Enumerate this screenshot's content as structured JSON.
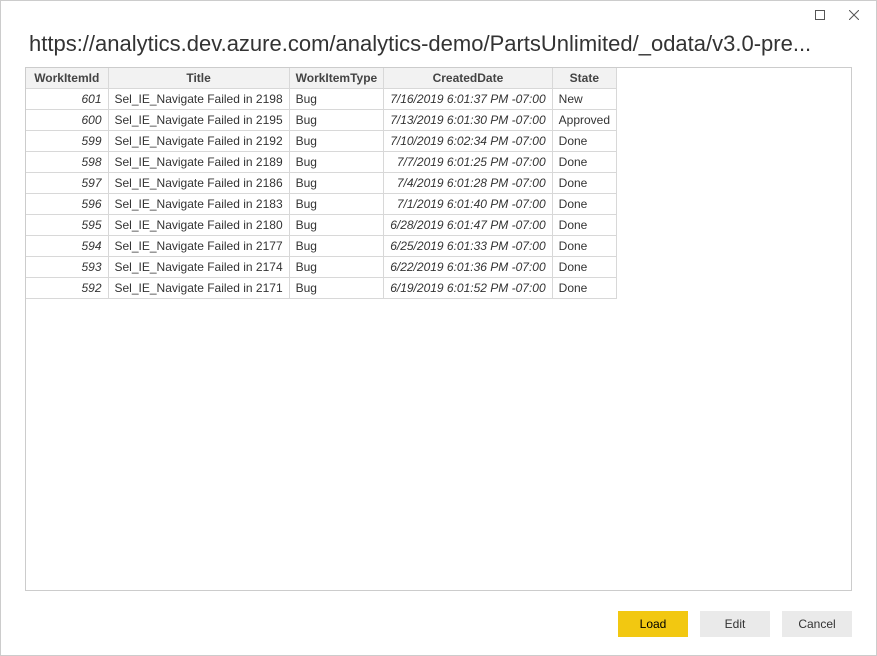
{
  "window": {
    "title_url": "https://analytics.dev.azure.com/analytics-demo/PartsUnlimited/_odata/v3.0-pre..."
  },
  "table": {
    "columns": {
      "id": "WorkItemId",
      "title": "Title",
      "type": "WorkItemType",
      "date": "CreatedDate",
      "state": "State"
    },
    "rows": [
      {
        "id": "601",
        "title": "Sel_IE_Navigate Failed in 2198",
        "type": "Bug",
        "date": "7/16/2019 6:01:37 PM -07:00",
        "state": "New"
      },
      {
        "id": "600",
        "title": "Sel_IE_Navigate Failed in 2195",
        "type": "Bug",
        "date": "7/13/2019 6:01:30 PM -07:00",
        "state": "Approved"
      },
      {
        "id": "599",
        "title": "Sel_IE_Navigate Failed in 2192",
        "type": "Bug",
        "date": "7/10/2019 6:02:34 PM -07:00",
        "state": "Done"
      },
      {
        "id": "598",
        "title": "Sel_IE_Navigate Failed in 2189",
        "type": "Bug",
        "date": "7/7/2019 6:01:25 PM -07:00",
        "state": "Done"
      },
      {
        "id": "597",
        "title": "Sel_IE_Navigate Failed in 2186",
        "type": "Bug",
        "date": "7/4/2019 6:01:28 PM -07:00",
        "state": "Done"
      },
      {
        "id": "596",
        "title": "Sel_IE_Navigate Failed in 2183",
        "type": "Bug",
        "date": "7/1/2019 6:01:40 PM -07:00",
        "state": "Done"
      },
      {
        "id": "595",
        "title": "Sel_IE_Navigate Failed in 2180",
        "type": "Bug",
        "date": "6/28/2019 6:01:47 PM -07:00",
        "state": "Done"
      },
      {
        "id": "594",
        "title": "Sel_IE_Navigate Failed in 2177",
        "type": "Bug",
        "date": "6/25/2019 6:01:33 PM -07:00",
        "state": "Done"
      },
      {
        "id": "593",
        "title": "Sel_IE_Navigate Failed in 2174",
        "type": "Bug",
        "date": "6/22/2019 6:01:36 PM -07:00",
        "state": "Done"
      },
      {
        "id": "592",
        "title": "Sel_IE_Navigate Failed in 2171",
        "type": "Bug",
        "date": "6/19/2019 6:01:52 PM -07:00",
        "state": "Done"
      }
    ]
  },
  "footer": {
    "load": "Load",
    "edit": "Edit",
    "cancel": "Cancel"
  }
}
